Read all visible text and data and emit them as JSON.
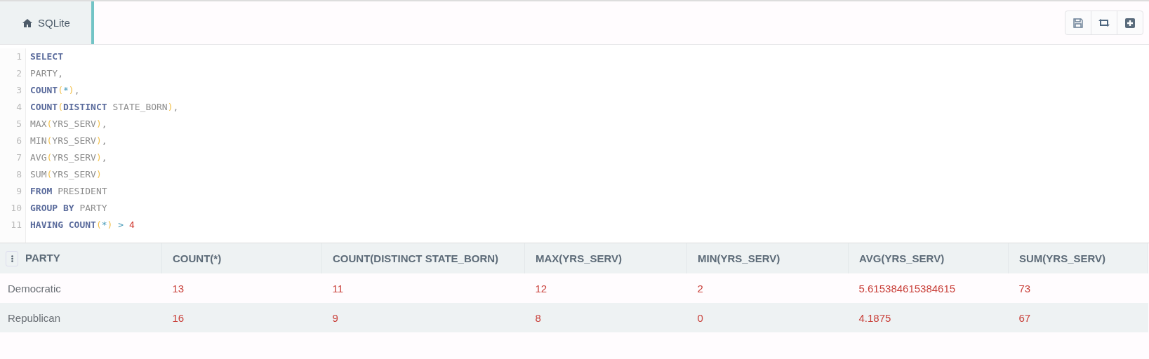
{
  "tabs": [
    {
      "label": "SQLite",
      "selected": true
    }
  ],
  "editor": {
    "lines": [
      [
        {
          "t": "SELECT",
          "kind": "kw"
        }
      ],
      [
        {
          "t": "PARTY",
          "kind": "id"
        },
        {
          "t": ",",
          "kind": "punct"
        }
      ],
      [
        {
          "t": "COUNT",
          "kind": "kw"
        },
        {
          "t": "(",
          "kind": "paren"
        },
        {
          "t": "*",
          "kind": "op"
        },
        {
          "t": ")",
          "kind": "paren"
        },
        {
          "t": ",",
          "kind": "punct"
        }
      ],
      [
        {
          "t": "COUNT",
          "kind": "kw"
        },
        {
          "t": "(",
          "kind": "paren"
        },
        {
          "t": "DISTINCT",
          "kind": "kw"
        },
        {
          "t": " STATE_BORN",
          "kind": "id"
        },
        {
          "t": ")",
          "kind": "paren"
        },
        {
          "t": ",",
          "kind": "punct"
        }
      ],
      [
        {
          "t": "MAX",
          "kind": "id"
        },
        {
          "t": "(",
          "kind": "paren"
        },
        {
          "t": "YRS_SERV",
          "kind": "id"
        },
        {
          "t": ")",
          "kind": "paren"
        },
        {
          "t": ",",
          "kind": "punct"
        }
      ],
      [
        {
          "t": "MIN",
          "kind": "id"
        },
        {
          "t": "(",
          "kind": "paren"
        },
        {
          "t": "YRS_SERV",
          "kind": "id"
        },
        {
          "t": ")",
          "kind": "paren"
        },
        {
          "t": ",",
          "kind": "punct"
        }
      ],
      [
        {
          "t": "AVG",
          "kind": "id"
        },
        {
          "t": "(",
          "kind": "paren"
        },
        {
          "t": "YRS_SERV",
          "kind": "id"
        },
        {
          "t": ")",
          "kind": "paren"
        },
        {
          "t": ",",
          "kind": "punct"
        }
      ],
      [
        {
          "t": "SUM",
          "kind": "id"
        },
        {
          "t": "(",
          "kind": "paren"
        },
        {
          "t": "YRS_SERV",
          "kind": "id"
        },
        {
          "t": ")",
          "kind": "paren"
        }
      ],
      [
        {
          "t": "FROM",
          "kind": "kw"
        },
        {
          "t": " PRESIDENT",
          "kind": "id"
        }
      ],
      [
        {
          "t": "GROUP BY",
          "kind": "kw"
        },
        {
          "t": " PARTY",
          "kind": "id"
        }
      ],
      [
        {
          "t": "HAVING COUNT",
          "kind": "kw"
        },
        {
          "t": "(",
          "kind": "paren"
        },
        {
          "t": "*",
          "kind": "op"
        },
        {
          "t": ")",
          "kind": "paren"
        },
        {
          "t": " > ",
          "kind": "op"
        },
        {
          "t": "4",
          "kind": "num"
        }
      ]
    ],
    "line_numbers": [
      "1",
      "2",
      "3",
      "4",
      "5",
      "6",
      "7",
      "8",
      "9",
      "10",
      "11"
    ]
  },
  "table": {
    "columns": [
      {
        "label": "PARTY",
        "kind": "text"
      },
      {
        "label": "COUNT(*)",
        "kind": "number"
      },
      {
        "label": "COUNT(DISTINCT STATE_BORN)",
        "kind": "number"
      },
      {
        "label": "MAX(YRS_SERV)",
        "kind": "number"
      },
      {
        "label": "MIN(YRS_SERV)",
        "kind": "number"
      },
      {
        "label": "AVG(YRS_SERV)",
        "kind": "number"
      },
      {
        "label": "SUM(YRS_SERV)",
        "kind": "number"
      }
    ],
    "rows": [
      [
        "Democratic",
        "13",
        "11",
        "12",
        "2",
        "5.615384615384615",
        "73"
      ],
      [
        "Republican",
        "16",
        "9",
        "8",
        "0",
        "4.1875",
        "67"
      ]
    ]
  }
}
